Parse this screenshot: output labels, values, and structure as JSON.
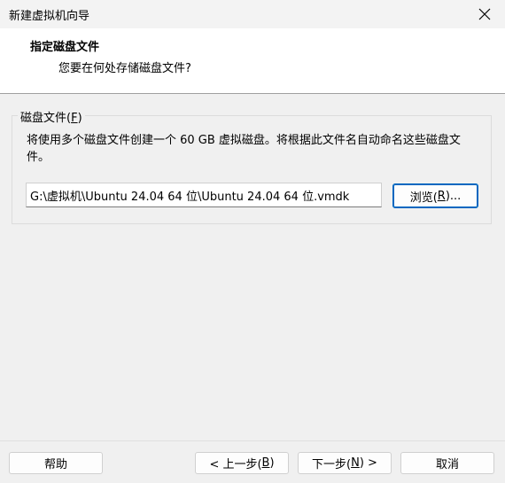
{
  "window": {
    "title": "新建虚拟机向导"
  },
  "header": {
    "title": "指定磁盘文件",
    "subtitle": "您要在何处存储磁盘文件?"
  },
  "disk_file_group": {
    "label_prefix": "磁盘文件(",
    "label_mnemonic": "F",
    "label_suffix": ")",
    "description": "将使用多个磁盘文件创建一个 60 GB 虚拟磁盘。将根据此文件名自动命名这些磁盘文件。",
    "path_value": "G:\\虚拟机\\Ubuntu 24.04 64 位\\Ubuntu 24.04 64 位.vmdk",
    "browse_prefix": "浏览(",
    "browse_mnemonic": "R",
    "browse_suffix": ")..."
  },
  "footer": {
    "help_label": "帮助",
    "back_prefix": "< 上一步(",
    "back_mnemonic": "B",
    "back_suffix": ")",
    "next_prefix": "下一步(",
    "next_mnemonic": "N",
    "next_suffix": ") >",
    "cancel_label": "取消"
  }
}
